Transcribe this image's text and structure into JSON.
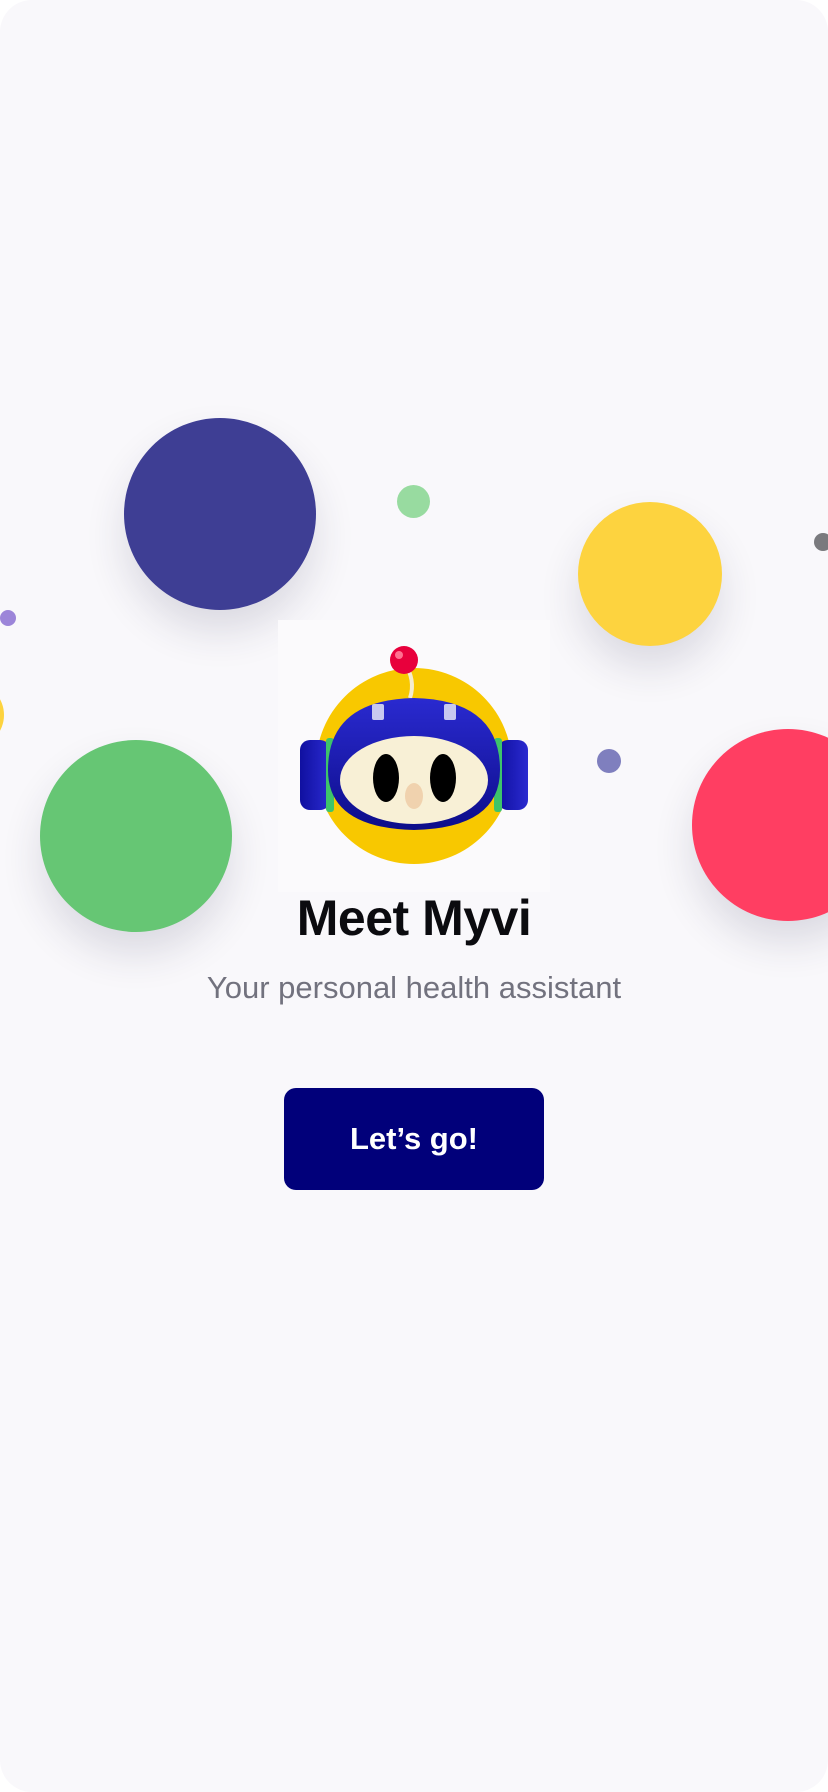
{
  "onboarding": {
    "title": "Meet Myvi",
    "subtitle": "Your personal health assistant",
    "cta_label": "Let’s go!"
  },
  "mascot": {
    "icon": "myvi-robot-mascot",
    "colors": {
      "halo": "#f8c800",
      "helmet": "#1a1ab8",
      "face": "#f8f0d6",
      "antenna_ball": "#e8003c",
      "ear_stripe": "#3ec46a"
    }
  },
  "theme": {
    "background": "#f9f8fb",
    "button": "#01007a",
    "bubble_colors": {
      "navy": "#3e3e94",
      "green": "#66c674",
      "yellow": "#fdd33f",
      "red": "#ff3e62",
      "light_green": "#98dba0",
      "purple": "#9c85d9",
      "violet": "#7f7fbe",
      "gray": "#7a7a7e"
    }
  }
}
